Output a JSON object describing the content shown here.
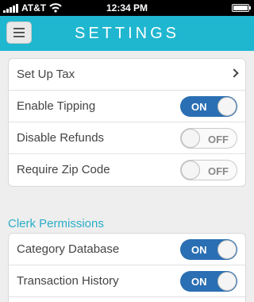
{
  "status_bar": {
    "carrier": "AT&T",
    "time": "12:34 PM",
    "icons": [
      "signal-icon",
      "wifi-icon",
      "battery-icon"
    ]
  },
  "nav": {
    "title": "SETTINGS",
    "menu_icon": "hamburger-menu-icon"
  },
  "general": {
    "items": [
      {
        "label": "Set Up Tax",
        "control": "chevron"
      },
      {
        "label": "Enable Tipping",
        "control": "toggle",
        "state": "ON"
      },
      {
        "label": "Disable Refunds",
        "control": "toggle",
        "state": "OFF"
      },
      {
        "label": "Require Zip Code",
        "control": "toggle",
        "state": "OFF"
      }
    ]
  },
  "clerk_permissions": {
    "title": "Clerk Permissions",
    "items": [
      {
        "label": "Category Database",
        "control": "toggle",
        "state": "ON"
      },
      {
        "label": "Transaction History",
        "control": "toggle",
        "state": "ON"
      }
    ]
  },
  "colors": {
    "accent": "#1fb6d0",
    "toggle_on": "#2a6fb3",
    "section_title": "#29aec8"
  }
}
